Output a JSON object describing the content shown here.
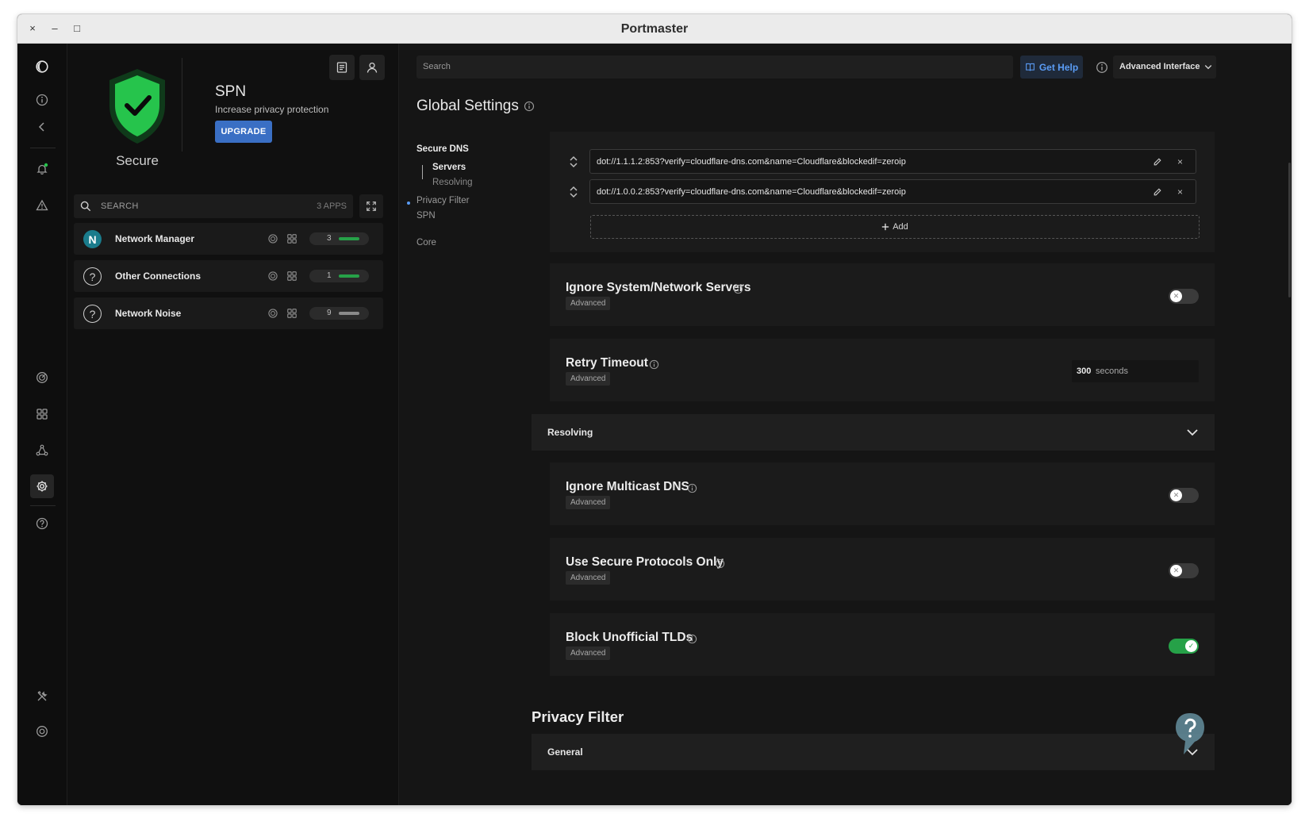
{
  "window": {
    "title": "Portmaster",
    "close": "×",
    "minimize": "–",
    "maximize": "□"
  },
  "status": {
    "label": "Secure"
  },
  "spn": {
    "title": "SPN",
    "subtitle": "Increase privacy protection",
    "upgrade_label": "UPGRADE"
  },
  "apps": {
    "search_placeholder": "SEARCH",
    "count": "3 APPS",
    "items": [
      {
        "initial": "N",
        "name": "Network Manager",
        "count": "3",
        "bar_color": "#26a148"
      },
      {
        "initial": "?",
        "name": "Other Connections",
        "count": "1",
        "bar_color": "#26a148"
      },
      {
        "initial": "?",
        "name": "Network Noise",
        "count": "9",
        "bar_color": "#8a8a8a"
      }
    ]
  },
  "topbar": {
    "search_placeholder": "Search",
    "help_label": "Get Help",
    "interface_select": "Advanced Interface"
  },
  "page": {
    "title": "Global Settings"
  },
  "nav": {
    "secure_dns": "Secure DNS",
    "servers": "Servers",
    "resolving": "Resolving",
    "privacy_filter": "Privacy Filter",
    "spn": "SPN",
    "core": "Core"
  },
  "dns_servers": {
    "entries": [
      "dot://1.1.1.2:853?verify=cloudflare-dns.com&name=Cloudflare&blockedif=zeroip",
      "dot://1.0.0.2:853?verify=cloudflare-dns.com&name=Cloudflare&blockedif=zeroip"
    ],
    "add_label": "Add",
    "delete_glyph": "×"
  },
  "settings": {
    "ignore_system": {
      "title": "Ignore System/Network Servers",
      "badge": "Advanced",
      "enabled": false
    },
    "retry_timeout": {
      "title": "Retry Timeout",
      "badge": "Advanced",
      "value": "300",
      "unit": "seconds"
    },
    "resolving_section": {
      "label": "Resolving"
    },
    "ignore_multicast": {
      "title": "Ignore Multicast DNS",
      "badge": "Advanced",
      "enabled": false
    },
    "secure_protocols": {
      "title": "Use Secure Protocols Only",
      "badge": "Advanced",
      "enabled": false
    },
    "block_tlds": {
      "title": "Block Unofficial TLDs",
      "badge": "Advanced",
      "enabled": true
    }
  },
  "privacy_filter": {
    "title": "Privacy Filter",
    "general_label": "General"
  },
  "colors": {
    "accent_blue": "#3a6fc4",
    "link_blue": "#5a9cf5",
    "success_green": "#26a148",
    "background": "#151515"
  }
}
